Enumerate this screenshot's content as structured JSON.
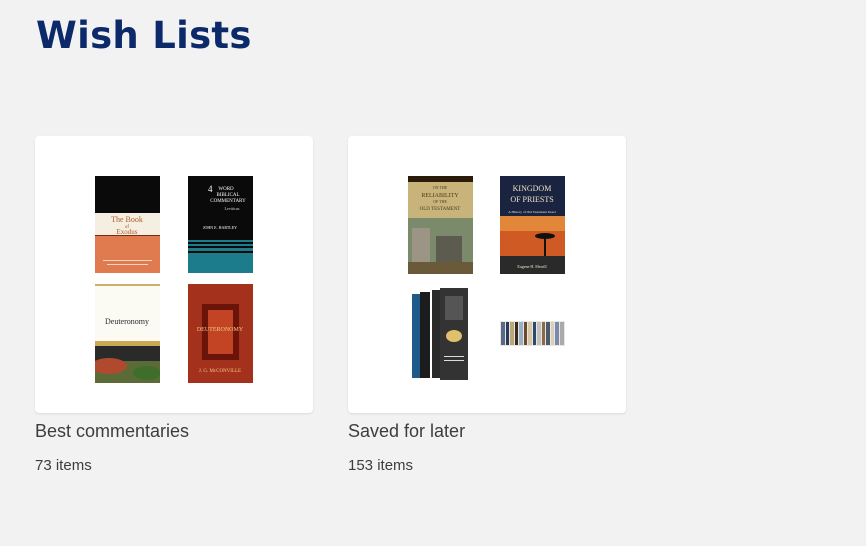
{
  "page": {
    "title": "Wish Lists"
  },
  "wishlists": [
    {
      "name": "Best commentaries",
      "count": "73 items",
      "covers": [
        {
          "name": "book-cover-exodus",
          "text": [
            "The Book",
            "of",
            "Exodus"
          ]
        },
        {
          "name": "book-cover-leviticus",
          "text": [
            "4",
            "WORD",
            "BIBLICAL",
            "COMMENTARY",
            "Leviticus",
            "JOHN E. HARTLEY"
          ]
        },
        {
          "name": "book-cover-deuteronomy",
          "text": [
            "Deuteronomy"
          ]
        },
        {
          "name": "book-cover-deuteronomy-mcconville",
          "text": [
            "DEUTERONOMY",
            "J. G. McCONVILLE"
          ]
        }
      ]
    },
    {
      "name": "Saved for later",
      "count": "153 items",
      "covers": [
        {
          "name": "book-cover-reliability-ot",
          "text": [
            "ON THE",
            "RELIABILITY",
            "OF THE",
            "OLD TESTAMENT"
          ]
        },
        {
          "name": "book-cover-kingdom-of-priests",
          "text": [
            "KINGDOM",
            "OF PRIESTS",
            "A History of Old Testament Israel",
            "Eugene H. Merrill"
          ]
        },
        {
          "name": "book-cover-box-set",
          "text": []
        },
        {
          "name": "book-cover-collection-spines",
          "text": []
        }
      ]
    }
  ]
}
